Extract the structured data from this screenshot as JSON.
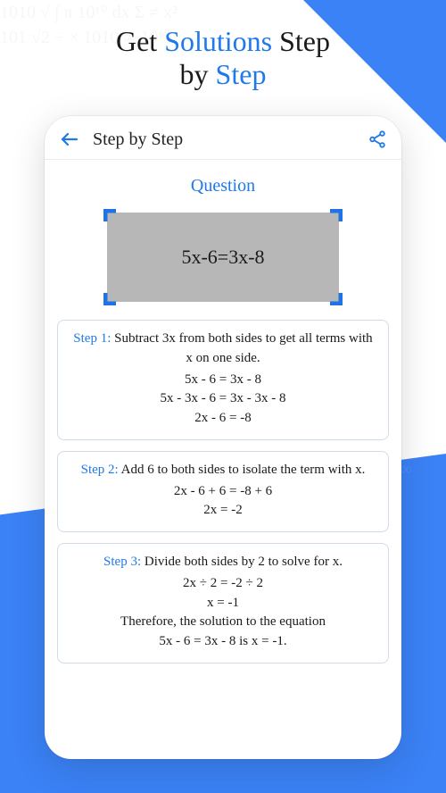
{
  "headline": {
    "p1": "Get ",
    "accent1": "Solutions",
    "p2": " Step",
    "p3": "by ",
    "accent2": "Step"
  },
  "app": {
    "title": "Step by Step"
  },
  "question": {
    "label": "Question",
    "equation": "5x-6=3x-8"
  },
  "steps": [
    {
      "label": "Step 1:",
      "desc": " Subtract 3x from both sides to get all terms with x on one side.",
      "lines": [
        "5x - 6 = 3x - 8",
        "5x - 3x - 6 = 3x - 3x - 8",
        "2x - 6 = -8"
      ]
    },
    {
      "label": "Step 2:",
      "desc": " Add 6 to both sides to isolate the term with x.",
      "lines": [
        "2x - 6 + 6 = -8 + 6",
        "2x = -2"
      ]
    },
    {
      "label": "Step 3:",
      "desc": " Divide both sides by 2 to solve for x.",
      "lines": [
        "2x ÷ 2 = -2 ÷ 2",
        "x = -1",
        "Therefore, the solution to the equation",
        "5x - 6 = 3x - 8 is x = -1."
      ]
    }
  ],
  "colors": {
    "accent": "#2079e8",
    "bg_triangle": "#3b82f6"
  }
}
